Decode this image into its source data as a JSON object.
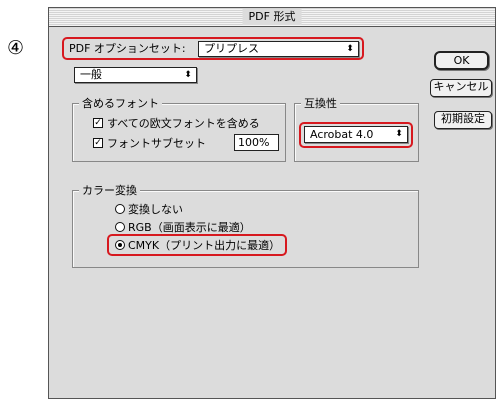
{
  "step_marker": "④",
  "window": {
    "title": "PDF 形式"
  },
  "preset": {
    "label": "PDF オプションセット:",
    "value": "プリプレス"
  },
  "section_select": {
    "value": "一般"
  },
  "buttons": {
    "ok": "OK",
    "cancel": "キャンセル",
    "defaults": "初期設定"
  },
  "fonts_group": {
    "title": "含めるフォント",
    "embed_all": {
      "label": "すべての欧文フォントを含める",
      "checked": true
    },
    "subset": {
      "label": "フォントサブセット",
      "checked": true,
      "value": "100%"
    }
  },
  "compat_group": {
    "title": "互換性",
    "value": "Acrobat 4.0"
  },
  "color_group": {
    "title": "カラー変換",
    "options": [
      {
        "label": "変換しない",
        "selected": false
      },
      {
        "label": "RGB（画面表示に最適）",
        "selected": false
      },
      {
        "label": "CMYK（プリント出力に最適）",
        "selected": true
      }
    ]
  },
  "colors": {
    "highlight": "#d7191f",
    "window_bg": "#dcdcdc"
  },
  "icons": {
    "checkbox": "check-icon",
    "popup": "updown-arrow-icon"
  }
}
